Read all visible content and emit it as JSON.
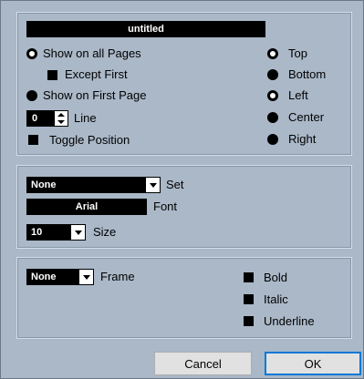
{
  "header": {
    "title_field": "untitled"
  },
  "pages": {
    "show_all": "Show on all Pages",
    "except_first": "Except First",
    "show_first": "Show on First Page",
    "line_value": "0",
    "line_label": "Line",
    "toggle_position": "Toggle Position"
  },
  "position": {
    "top": "Top",
    "bottom": "Bottom",
    "left": "Left",
    "center": "Center",
    "right": "Right"
  },
  "style": {
    "set_value": "None",
    "set_label": "Set",
    "font_value": "Arial",
    "font_label": "Font",
    "size_value": "10",
    "size_label": "Size"
  },
  "frame": {
    "frame_value": "None",
    "frame_label": "Frame",
    "bold": "Bold",
    "italic": "Italic",
    "underline": "Underline"
  },
  "buttons": {
    "cancel": "Cancel",
    "ok": "OK"
  },
  "colors": {
    "background": "#aab8c8",
    "accent": "#0078d7"
  }
}
